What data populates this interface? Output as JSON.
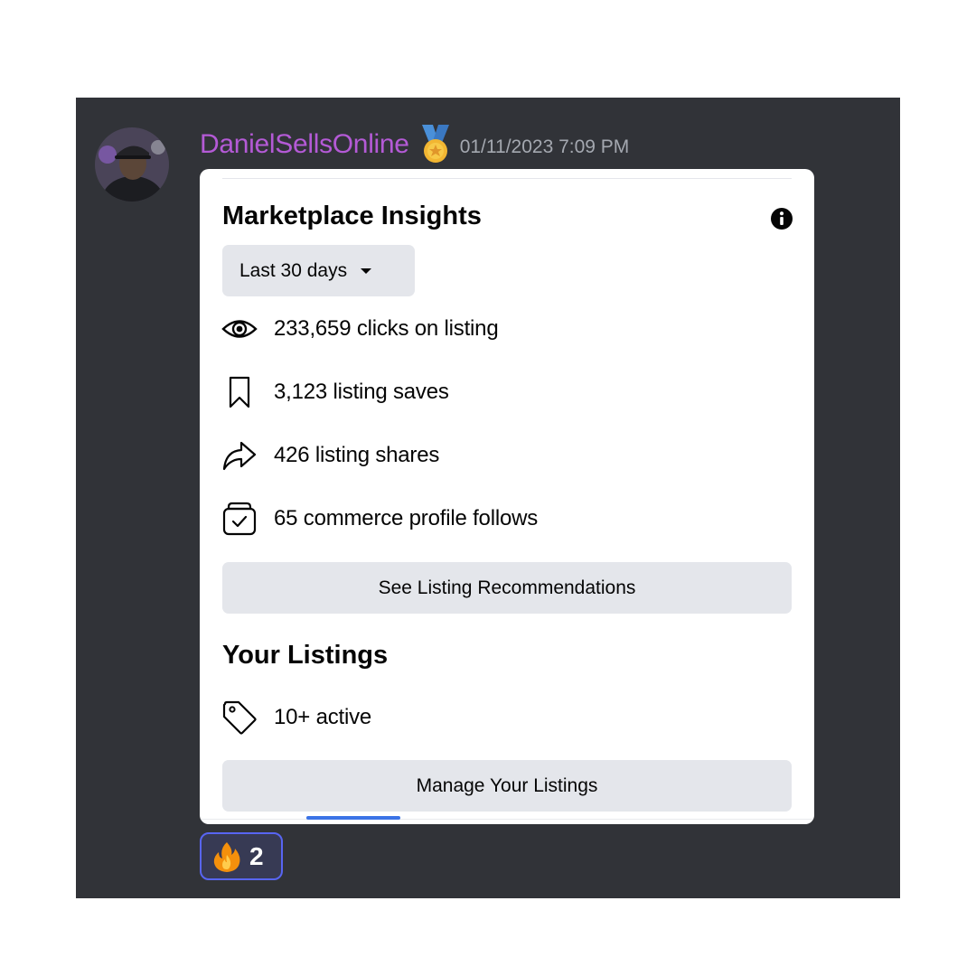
{
  "message": {
    "username": "DanielSellsOnline",
    "badge_icon": "medal-icon",
    "timestamp": "01/11/2023 7:09 PM",
    "username_color": "#b45ad6"
  },
  "insights": {
    "title": "Marketplace Insights",
    "info_icon": "info-icon",
    "range_selected": "Last 30 days",
    "stats": [
      {
        "icon": "eye-icon",
        "text": "233,659 clicks on listing"
      },
      {
        "icon": "bookmark-icon",
        "text": "3,123 listing saves"
      },
      {
        "icon": "share-icon",
        "text": "426 listing shares"
      },
      {
        "icon": "commerce-profile-icon",
        "text": "65 commerce profile follows"
      }
    ],
    "recommendations_button": "See Listing Recommendations"
  },
  "listings": {
    "title": "Your Listings",
    "active": {
      "icon": "tag-icon",
      "text": "10+ active"
    },
    "manage_button": "Manage Your Listings"
  },
  "reaction": {
    "emoji_icon": "fire-icon",
    "count": "2",
    "accent": "#5865f2"
  },
  "colors": {
    "panel_background": "#313338",
    "button_background": "#e4e6eb",
    "tab_indicator": "#3b73e6"
  }
}
